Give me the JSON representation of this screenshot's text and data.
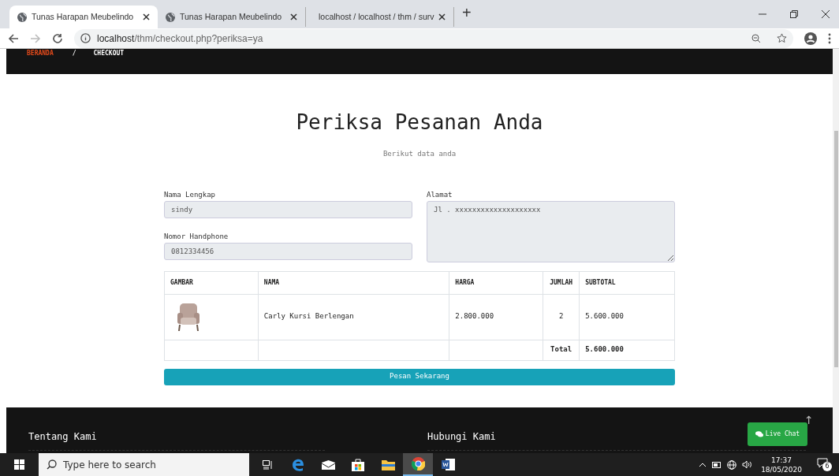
{
  "browser": {
    "tabs": [
      {
        "title": "Tunas Harapan Meubelindo",
        "kind": "globe",
        "selected": true
      },
      {
        "title": "Tunas Harapan Meubelindo",
        "kind": "globe",
        "selected": false
      },
      {
        "title": "localhost / localhost / thm / surv",
        "kind": "pma",
        "selected": false
      }
    ],
    "new_tab": "+",
    "address": {
      "host": "localhost",
      "path": "/thm/checkout.php?periksa=ya"
    }
  },
  "breadcrumb": [
    {
      "label": "BERANDA",
      "selected": false
    },
    {
      "label": "/",
      "kind": "sep"
    },
    {
      "label": "CHECKOUT",
      "selected": true
    }
  ],
  "heading": "Periksa Pesanan Anda",
  "subheading": "Berikut data anda",
  "form": {
    "nama": {
      "label": "Nama Lengkap",
      "value": "sindy"
    },
    "phone": {
      "label": "Nomor Handphone",
      "value": "0812334456"
    },
    "alamat": {
      "label": "Alamat",
      "value": "Jl . xxxxxxxxxxxxxxxxxxxx"
    }
  },
  "table": {
    "columns": [
      "GAMBAR",
      "NAMA",
      "HARGA",
      "JUMLAH",
      "SUBTOTAL"
    ],
    "rows": [
      {
        "name": "Carly Kursi Berlengan",
        "price": "2.800.000",
        "qty": "2",
        "subtotal": "5.600.000"
      }
    ],
    "total_label": "Total",
    "total_value": "5.600.000"
  },
  "order_button": "Pesan Sekarang",
  "footer": {
    "headings": [
      "Tentang Kami",
      "Hubungi Kami"
    ],
    "live_chat": "Live Chat",
    "back_to_top": "↑"
  },
  "taskbar": {
    "search_placeholder": "Type here to search",
    "apps": [
      {
        "kind": "taskview",
        "selected": false
      },
      {
        "kind": "edge",
        "selected": false
      },
      {
        "kind": "mail",
        "selected": false
      },
      {
        "kind": "store",
        "selected": false
      },
      {
        "kind": "explorer",
        "selected": false
      },
      {
        "kind": "chrome",
        "selected": true
      },
      {
        "kind": "word",
        "selected": false
      }
    ],
    "time": "17:37",
    "date": "18/05/2020",
    "notifications": "6"
  }
}
